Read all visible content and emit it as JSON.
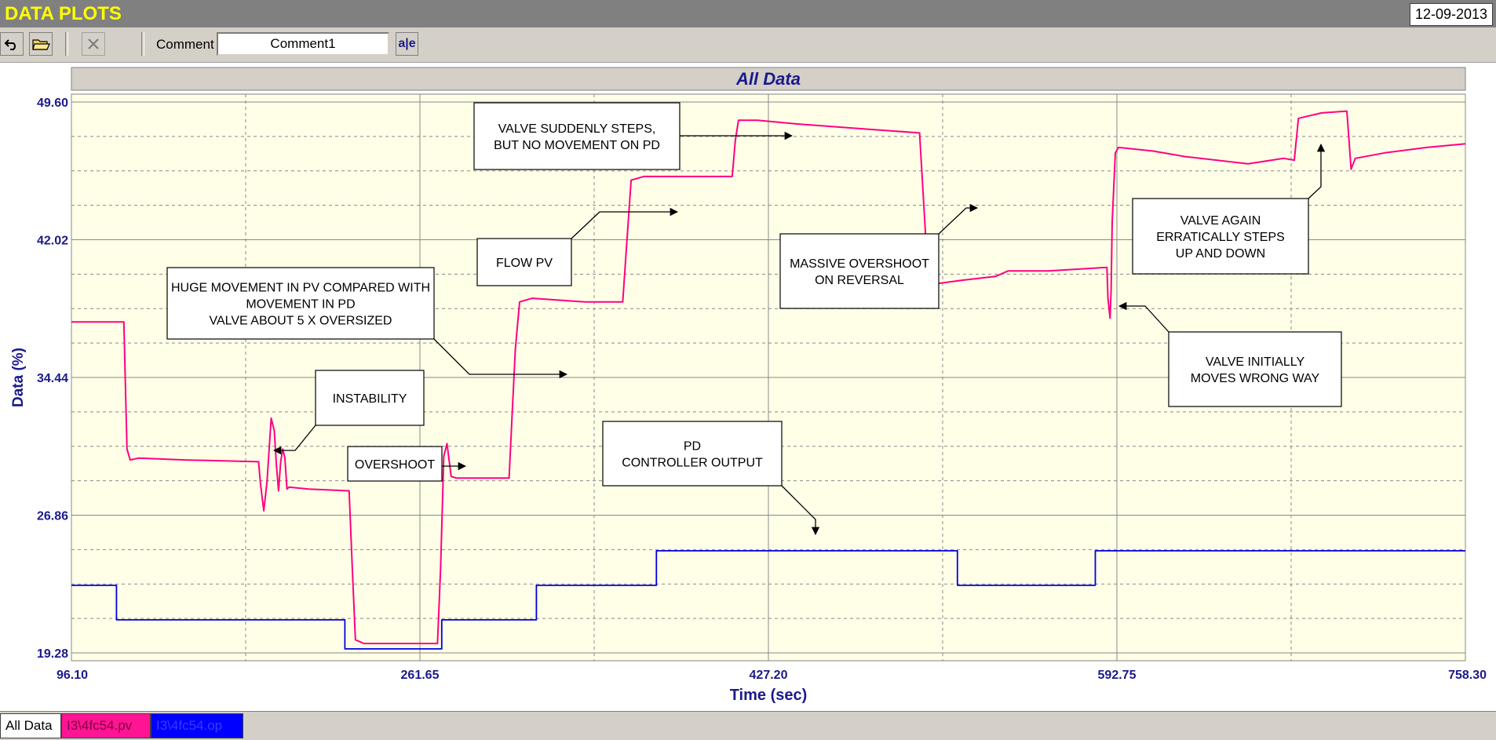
{
  "app": {
    "title": "DATA PLOTS",
    "date": "12-09-2013"
  },
  "toolbar": {
    "comment_label": "Comment",
    "comment_value": "Comment1",
    "text_tool_label": "a|e"
  },
  "tabs": [
    {
      "label": "All Data",
      "color": "#ffffff",
      "active": true
    },
    {
      "label": "I3\\4fc54.pv",
      "color": "#ff1493",
      "active": false
    },
    {
      "label": "I3\\4fc54.op",
      "color": "#0000ff",
      "active": false
    }
  ],
  "colors": {
    "pv": "#ff0080",
    "op": "#0000e0",
    "plot_bg": "#ffffe8",
    "axis_text": "#1a1a8c"
  },
  "chart_data": {
    "type": "line",
    "title": "All Data",
    "xlabel": "Time (sec)",
    "ylabel": "Data (%)",
    "xlim": [
      96.1,
      758.3
    ],
    "ylim": [
      19.28,
      49.6
    ],
    "xticks": [
      "96.10",
      "261.65",
      "427.20",
      "592.75",
      "758.30"
    ],
    "yticks": [
      "19.28",
      "26.86",
      "34.44",
      "42.02",
      "49.60"
    ],
    "grid": true,
    "series": [
      {
        "name": "I3\\4fc54.pv",
        "points": [
          [
            96.1,
            37.5
          ],
          [
            121,
            37.5
          ],
          [
            122.5,
            30.5
          ],
          [
            124,
            29.9
          ],
          [
            128,
            30.0
          ],
          [
            150,
            29.9
          ],
          [
            185,
            29.8
          ],
          [
            186,
            28.5
          ],
          [
            187.5,
            27.1
          ],
          [
            189,
            28.7
          ],
          [
            191,
            32.2
          ],
          [
            192.5,
            31.5
          ],
          [
            193.5,
            29.6
          ],
          [
            194.5,
            28.2
          ],
          [
            195.5,
            29.8
          ],
          [
            196.5,
            30.5
          ],
          [
            197.5,
            30.0
          ],
          [
            198.5,
            28.3
          ],
          [
            199.5,
            28.4
          ],
          [
            209,
            28.3
          ],
          [
            228,
            28.2
          ],
          [
            229.5,
            24.0
          ],
          [
            231,
            20.0
          ],
          [
            235,
            19.8
          ],
          [
            270,
            19.8
          ],
          [
            271.5,
            24.0
          ],
          [
            273,
            30.1
          ],
          [
            274.5,
            30.8
          ],
          [
            276.5,
            29.0
          ],
          [
            279,
            28.9
          ],
          [
            304,
            28.9
          ],
          [
            305.5,
            32.5
          ],
          [
            307,
            36.0
          ],
          [
            309,
            38.6
          ],
          [
            315,
            38.8
          ],
          [
            340,
            38.6
          ],
          [
            358,
            38.6
          ],
          [
            360,
            42.0
          ],
          [
            362,
            45.3
          ],
          [
            368,
            45.5
          ],
          [
            400,
            45.5
          ],
          [
            410,
            45.5
          ],
          [
            411.5,
            47.5
          ],
          [
            413,
            48.6
          ],
          [
            422,
            48.6
          ],
          [
            440,
            48.4
          ],
          [
            475,
            48.1
          ],
          [
            499,
            47.9
          ],
          [
            501,
            44.0
          ],
          [
            503,
            40.0
          ],
          [
            507,
            39.6
          ],
          [
            520,
            39.8
          ],
          [
            535,
            40.0
          ],
          [
            541,
            40.3
          ],
          [
            560,
            40.3
          ],
          [
            588,
            40.5
          ],
          [
            588.5,
            38.8
          ],
          [
            589.5,
            37.7
          ],
          [
            590,
            39.2
          ],
          [
            590.5,
            43.0
          ],
          [
            592,
            46.8
          ],
          [
            593.5,
            47.1
          ],
          [
            610,
            46.9
          ],
          [
            625,
            46.6
          ],
          [
            655,
            46.2
          ],
          [
            672,
            46.5
          ],
          [
            677,
            46.4
          ],
          [
            679,
            48.7
          ],
          [
            690,
            49.0
          ],
          [
            702,
            49.1
          ],
          [
            703,
            47.5
          ],
          [
            704,
            45.9
          ],
          [
            706,
            46.5
          ],
          [
            720,
            46.8
          ],
          [
            740,
            47.1
          ],
          [
            758.3,
            47.3
          ]
        ]
      },
      {
        "name": "I3\\4fc54.op",
        "points": [
          [
            96.1,
            23.0
          ],
          [
            117.5,
            23.0
          ],
          [
            117.5,
            21.1
          ],
          [
            226,
            21.1
          ],
          [
            226,
            19.5
          ],
          [
            272,
            19.5
          ],
          [
            272,
            21.1
          ],
          [
            317,
            21.1
          ],
          [
            317,
            23.0
          ],
          [
            374,
            23.0
          ],
          [
            374,
            24.9
          ],
          [
            517,
            24.9
          ],
          [
            517,
            23.0
          ],
          [
            582.5,
            23.0
          ],
          [
            582.5,
            24.9
          ],
          [
            758.3,
            24.9
          ]
        ]
      }
    ],
    "annotations": [
      {
        "id": "valve-steps",
        "lines": [
          "VALVE SUDDENLY STEPS,",
          "BUT NO MOVEMENT ON PD"
        ]
      },
      {
        "id": "flow-pv",
        "lines": [
          "FLOW PV"
        ]
      },
      {
        "id": "massive-overshoot",
        "lines": [
          "MASSIVE OVERSHOOT",
          "ON REVERSAL"
        ]
      },
      {
        "id": "valve-again",
        "lines": [
          "VALVE AGAIN",
          "ERRATICALLY STEPS",
          "UP AND DOWN"
        ]
      },
      {
        "id": "huge-movement",
        "lines": [
          "HUGE MOVEMENT IN PV COMPARED WITH",
          "MOVEMENT IN PD",
          "VALVE ABOUT 5 X OVERSIZED"
        ]
      },
      {
        "id": "valve-initially",
        "lines": [
          "VALVE INITIALLY",
          "MOVES WRONG WAY"
        ]
      },
      {
        "id": "instability",
        "lines": [
          "INSTABILITY"
        ]
      },
      {
        "id": "overshoot",
        "lines": [
          "OVERSHOOT"
        ]
      },
      {
        "id": "pd-output",
        "lines": [
          "PD",
          "CONTROLLER OUTPUT"
        ]
      }
    ]
  }
}
